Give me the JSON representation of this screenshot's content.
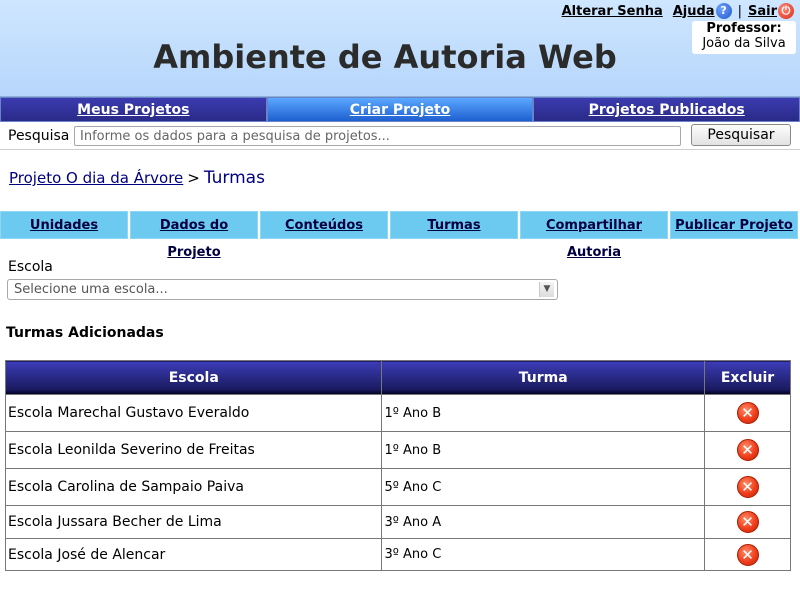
{
  "header": {
    "title": "Ambiente de Autoria Web",
    "links": {
      "alterar_senha": "Alterar Senha",
      "ajuda": "Ajuda",
      "sep": "|",
      "sair": "Sair"
    },
    "professor_role": "Professor:",
    "professor_name": "João da Silva"
  },
  "main_nav": {
    "items": [
      {
        "label": "Meus Projetos"
      },
      {
        "label": "Criar Projeto"
      },
      {
        "label": "Projetos Publicados"
      }
    ],
    "active": "Criar Projeto"
  },
  "search": {
    "label": "Pesquisa",
    "placeholder": "Informe os dados para a pesquisa de projetos...",
    "button_label": "Pesquisar"
  },
  "breadcrumb": {
    "project_link": "Projeto O dia da Árvore",
    "separator": ">",
    "current": "Turmas"
  },
  "sub_tabs": [
    {
      "label": "Unidades"
    },
    {
      "label": "Dados do Projeto"
    },
    {
      "label": "Conteúdos"
    },
    {
      "label": "Turmas"
    },
    {
      "label": "Compartilhar Autoria"
    },
    {
      "label": "Publicar Projeto"
    }
  ],
  "escola": {
    "label": "Escola",
    "placeholder": "Selecione uma escola..."
  },
  "turmas_section": {
    "title": "Turmas Adicionadas",
    "columns": [
      "Escola",
      "Turma",
      "Excluir"
    ],
    "rows": [
      {
        "escola": "Escola Marechal Gustavo Everaldo",
        "turma": "1º Ano B"
      },
      {
        "escola": "Escola Leonilda Severino de Freitas",
        "turma": "1º Ano B"
      },
      {
        "escola": "Escola Carolina de Sampaio Paiva",
        "turma": "5º Ano C"
      },
      {
        "escola": "Escola Jussara Becher de Lima",
        "turma": "3º Ano A"
      },
      {
        "escola": "Escola José de Alencar",
        "turma": "3º Ano C"
      }
    ]
  },
  "icons": {
    "help": "help-icon",
    "power": "power-icon",
    "delete": "delete-icon"
  }
}
